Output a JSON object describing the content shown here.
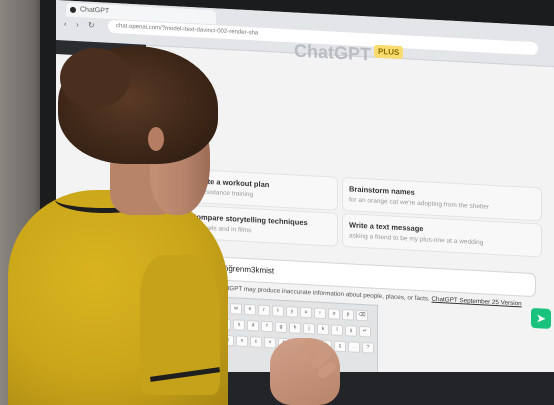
{
  "browser": {
    "tab_title": "ChatGPT",
    "url": "chat.openai.com/?model=text-davinci-002-render-sha"
  },
  "header": {
    "brand": "ChatGPT",
    "badge": "PLUS"
  },
  "suggestions": [
    {
      "title": "Create a workout plan",
      "subtitle": "for resistance training"
    },
    {
      "title": "Brainstorm names",
      "subtitle": "for an orange cat we're adopting from the shelter"
    },
    {
      "title": "Compare storytelling techniques",
      "subtitle": "in novels and in films"
    },
    {
      "title": "Write a text message",
      "subtitle": "asking a friend to be my plus-one at a wedding"
    }
  ],
  "prompt": {
    "value": "kodlarını öğrenm3kmist"
  },
  "footer": {
    "disclaimer": "ChatGPT may produce inaccurate information about people, places, or facts.",
    "version_link": "ChatGPT September 25 Version"
  },
  "keyboard": {
    "row1": [
      "q",
      "w",
      "e",
      "r",
      "t",
      "y",
      "u",
      "ı",
      "o",
      "p",
      "⌫"
    ],
    "row2": [
      "a",
      "s",
      "d",
      "f",
      "g",
      "h",
      "j",
      "k",
      "l",
      "ş",
      "↵"
    ],
    "row3": [
      "z",
      "x",
      "c",
      "v",
      "b",
      "n",
      "m",
      "ö",
      "ç",
      ".",
      "?"
    ]
  },
  "colors": {
    "send_button": "#19c37d",
    "badge_bg": "#f7dc6f",
    "shirt": "#caa51a"
  }
}
